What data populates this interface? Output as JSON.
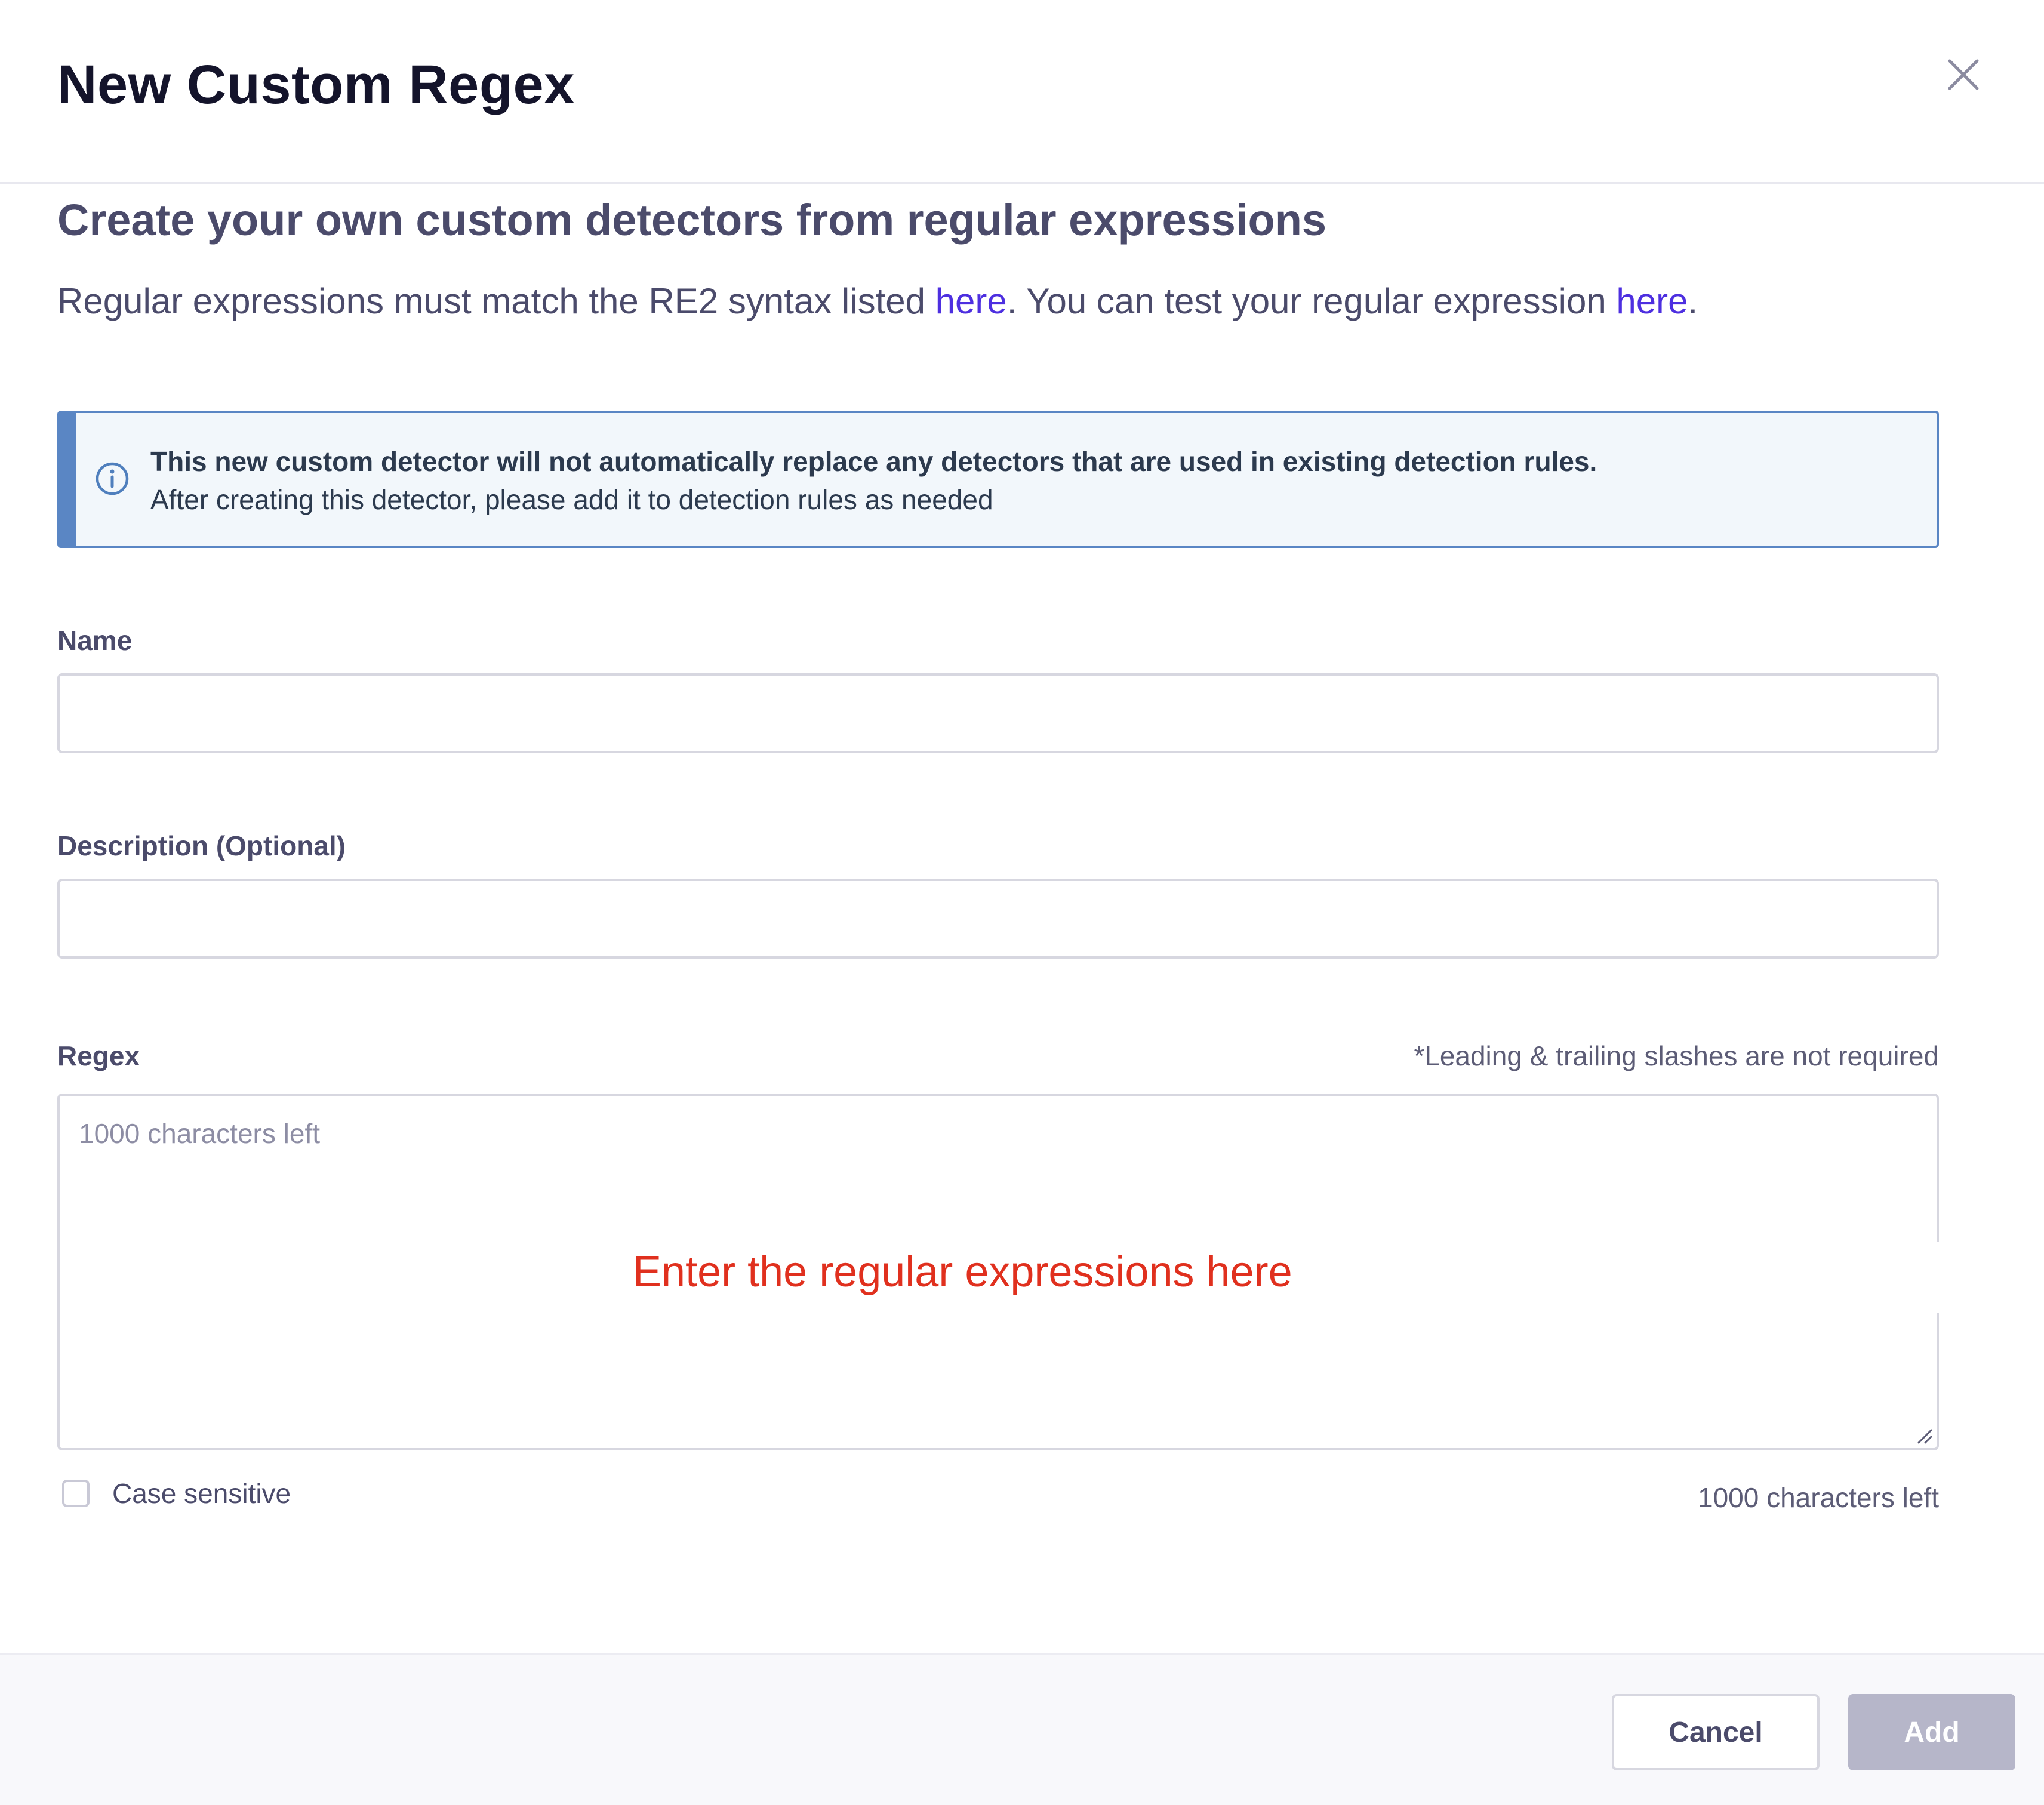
{
  "dialog": {
    "title": "New Custom Regex",
    "close_icon": "close-icon"
  },
  "intro": {
    "heading": "Create your own custom detectors from regular expressions",
    "text_before_link1": "Regular expressions must match the RE2 syntax listed ",
    "link1_label": "here",
    "text_between_links": ". You can test your regular expression ",
    "link2_label": "here",
    "text_after_link2": ".",
    "link_color": "#4d2fe0"
  },
  "info_banner": {
    "icon": "info-circle-icon",
    "title": "This new custom detector will not automatically replace any detectors that are used in existing detection rules.",
    "text": "After creating this detector, please add it to detection rules as needed",
    "accent_color": "#5a86c4",
    "background_color": "#f2f7fb"
  },
  "form": {
    "name_label": "Name",
    "name_value": "",
    "description_label": "Description (Optional)",
    "description_value": "",
    "regex_label": "Regex",
    "regex_hint": "*Leading & trailing slashes are not required",
    "regex_placeholder": "1000 characters left",
    "regex_value": "",
    "case_sensitive_label": "Case sensitive",
    "case_sensitive_checked": false,
    "characters_left": "1000 characters left"
  },
  "annotation": {
    "text": "Enter the regular expressions here",
    "color": "#e0301e"
  },
  "footer": {
    "cancel_label": "Cancel",
    "add_label": "Add",
    "add_disabled": true,
    "add_color": "#b6b6c9"
  }
}
